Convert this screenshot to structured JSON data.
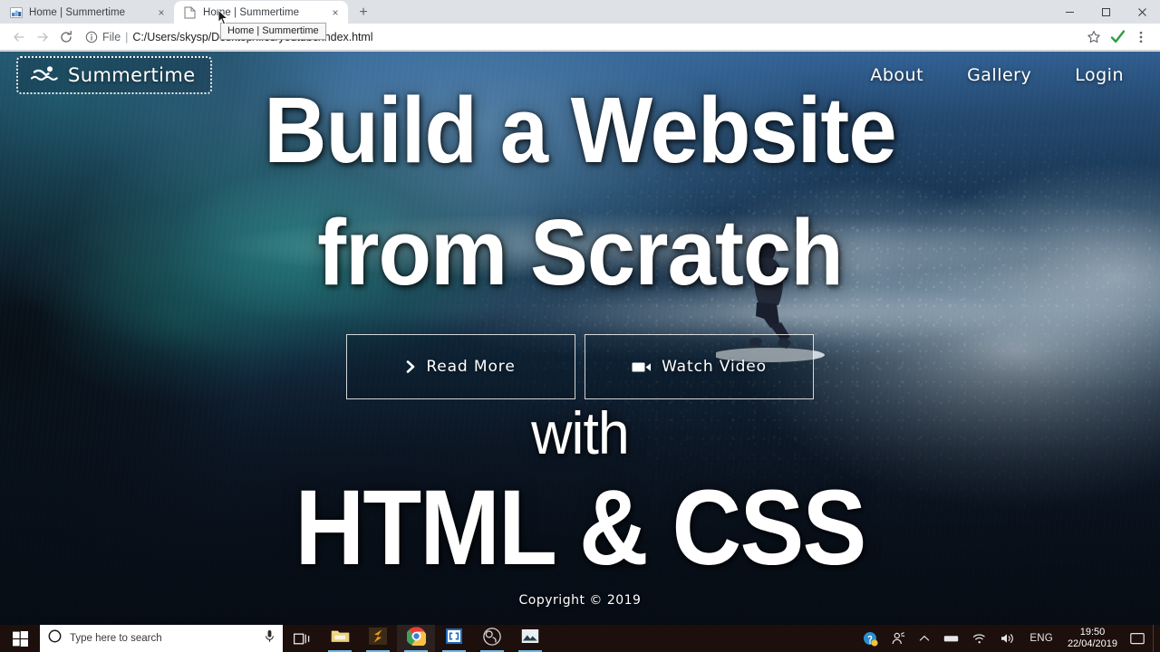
{
  "browser": {
    "tabs": [
      {
        "title": "Home | Summertime",
        "favicon": "image-favicon",
        "active": false,
        "close_label": "×"
      },
      {
        "title": "Home | Summertime",
        "favicon": "document-favicon",
        "active": true,
        "close_label": "×"
      }
    ],
    "new_tab_label": "+",
    "tab_tooltip": "Home | Summertime",
    "window_controls": {
      "minimize": "—",
      "maximize": "❐",
      "close": "✕"
    },
    "toolbar": {
      "back_label": "←",
      "forward_label": "→",
      "reload_label": "↻",
      "site_info_icon": "info-circle-icon",
      "scheme_label": "File",
      "scheme_separator": "|",
      "url": "C:/Users/skysp/Desktop/files/youtube/index.html",
      "bookmark_icon": "star-icon",
      "extension_icon": "green-check-icon",
      "menu_icon": "three-dot-menu-icon"
    }
  },
  "site": {
    "logo": {
      "icon": "swimmer-icon",
      "text": "Summertime"
    },
    "nav": [
      {
        "label": "About"
      },
      {
        "label": "Gallery"
      },
      {
        "label": "Login"
      }
    ],
    "buttons": [
      {
        "label": "Read More",
        "icon": "chevron-right-icon"
      },
      {
        "label": "Watch Video",
        "icon": "video-camera-icon"
      }
    ],
    "copyright": "Copyright © 2019"
  },
  "overlay": {
    "line1": "Build a Website",
    "line2": "from Scratch",
    "line3": "with",
    "line4": "HTML & CSS"
  },
  "taskbar": {
    "start_icon": "windows-logo-icon",
    "search_placeholder": "Type here to search",
    "search_icon": "cortana-circle-icon",
    "mic_icon": "microphone-icon",
    "task_view_icon": "task-view-icon",
    "apps": [
      {
        "name": "file-explorer",
        "icon": "folder-icon"
      },
      {
        "name": "sublime-text",
        "icon": "sublime-icon"
      },
      {
        "name": "google-chrome",
        "icon": "chrome-icon"
      },
      {
        "name": "brackets",
        "icon": "brackets-icon"
      },
      {
        "name": "obs-studio",
        "icon": "obs-icon"
      },
      {
        "name": "photos",
        "icon": "photos-icon"
      }
    ],
    "tray": {
      "help_icon": "help-question-icon",
      "people_icon": "people-icon",
      "chevron_icon": "chevron-up-icon",
      "device_icon": "device-icon",
      "network_icon": "wifi-icon",
      "volume_icon": "speaker-icon",
      "language": "ENG",
      "time": "19:50",
      "date": "22/04/2019",
      "action_center_icon": "action-center-icon"
    }
  },
  "colors": {
    "chrome_frame": "#dee1e6",
    "chrome_active_tab": "#ffffff",
    "taskbar": "#1c0f0c",
    "accent_check": "#2e9e3f",
    "running_underline": "#6fb7ea"
  }
}
